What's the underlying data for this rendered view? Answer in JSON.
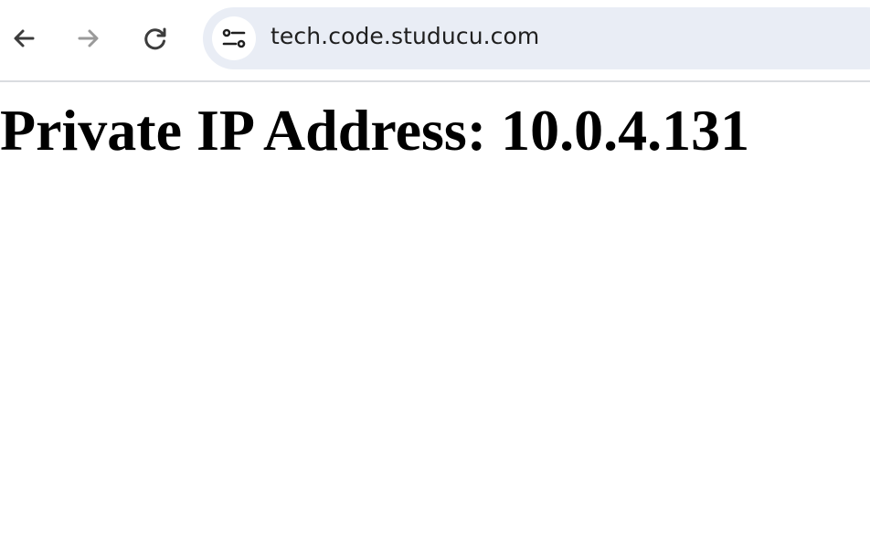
{
  "browser": {
    "icons": {
      "back": "arrow-left-icon",
      "forward": "arrow-right-icon",
      "reload": "reload-icon",
      "site_info": "tune-icon"
    },
    "address_bar": {
      "url": "tech.code.studucu.com"
    }
  },
  "page": {
    "heading": "Private IP Address: 10.0.4.131"
  }
}
